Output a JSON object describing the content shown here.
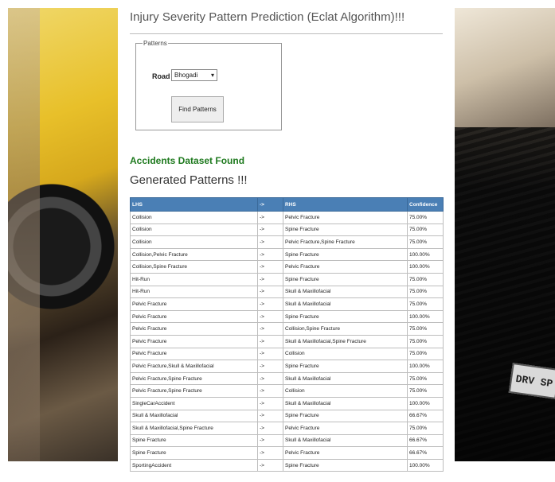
{
  "page_title": "Injury Severity Pattern Prediction (Eclat Algorithm)!!!",
  "form": {
    "legend": "Patterns",
    "road_label": "Road",
    "road_value": "Bhogadi",
    "find_button": "Find Patterns"
  },
  "dataset_found": "Accidents Dataset Found",
  "generated_patterns": "Generated Patterns !!!",
  "table": {
    "headers": [
      "LHS",
      "->",
      "RHS",
      "Confidence"
    ],
    "rows": [
      [
        "Collision",
        "->",
        "Pelvic Fracture",
        "75.00%"
      ],
      [
        "Collision",
        "->",
        "Spine Fracture",
        "75.00%"
      ],
      [
        "Collision",
        "->",
        "Pelvic Fracture,Spine Fracture",
        "75.00%"
      ],
      [
        "Collision,Pelvic Fracture",
        "->",
        "Spine Fracture",
        "100.00%"
      ],
      [
        "Collision,Spine Fracture",
        "->",
        "Pelvic Fracture",
        "100.00%"
      ],
      [
        "Hit-Run",
        "->",
        "Spine Fracture",
        "75.00%"
      ],
      [
        "Hit-Run",
        "->",
        "Skull & Maxillofacial",
        "75.00%"
      ],
      [
        "Pelvic Fracture",
        "->",
        "Skull & Maxillofacial",
        "75.00%"
      ],
      [
        "Pelvic Fracture",
        "->",
        "Spine Fracture",
        "100.00%"
      ],
      [
        "Pelvic Fracture",
        "->",
        "Collision,Spine Fracture",
        "75.00%"
      ],
      [
        "Pelvic Fracture",
        "->",
        "Skull & Maxillofacial,Spine Fracture",
        "75.00%"
      ],
      [
        "Pelvic Fracture",
        "->",
        "Collision",
        "75.00%"
      ],
      [
        "Pelvic Fracture,Skull & Maxillofacial",
        "->",
        "Spine Fracture",
        "100.00%"
      ],
      [
        "Pelvic Fracture,Spine Fracture",
        "->",
        "Skull & Maxillofacial",
        "75.00%"
      ],
      [
        "Pelvic Fracture,Spine Fracture",
        "->",
        "Collision",
        "75.00%"
      ],
      [
        "SingleCarAccident",
        "->",
        "Skull & Maxillofacial",
        "100.00%"
      ],
      [
        "Skull & Maxillofacial",
        "->",
        "Spine Fracture",
        "66.67%"
      ],
      [
        "Skull & Maxillofacial,Spine Fracture",
        "->",
        "Pelvic Fracture",
        "75.00%"
      ],
      [
        "Spine Fracture",
        "->",
        "Skull & Maxillofacial",
        "66.67%"
      ],
      [
        "Spine Fracture",
        "->",
        "Pelvic Fracture",
        "66.67%"
      ],
      [
        "SportingAccident",
        "->",
        "Spine Fracture",
        "100.00%"
      ]
    ]
  },
  "decor": {
    "left_image": "yellow-muscle-car",
    "right_image": "dark-truck-with-plate",
    "plate_text": "DRV SP"
  },
  "colors": {
    "header_bg": "#4a7fb5",
    "found_text": "#1f7a1f"
  }
}
